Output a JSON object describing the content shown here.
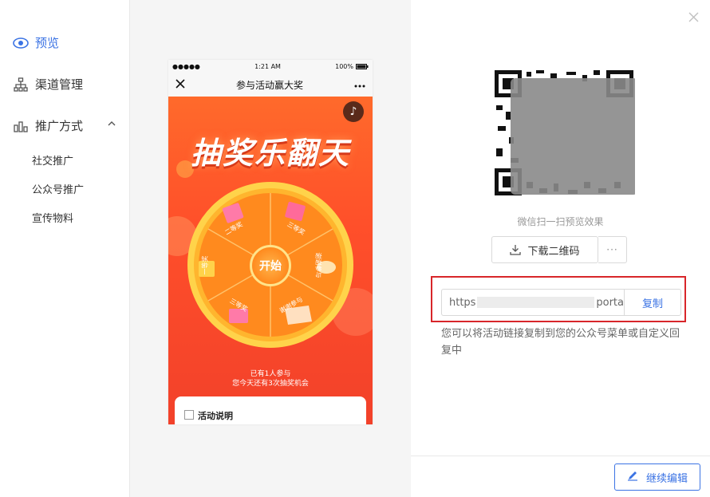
{
  "sidebar": {
    "items": [
      {
        "label": "预览",
        "icon": "eye-icon",
        "active": true
      },
      {
        "label": "渠道管理",
        "icon": "org-chart-icon"
      },
      {
        "label": "推广方式",
        "icon": "bar-chart-icon"
      }
    ],
    "sub_items": [
      "社交推广",
      "公众号推广",
      "宣传物料"
    ]
  },
  "phone": {
    "status_dots": "●●●●●",
    "status_time": "1:21 AM",
    "status_battery": "100%",
    "title": "参与活动赢大奖",
    "hero_title": "抽奖乐翻天",
    "wheel_labels": [
      "二等奖",
      "三等奖",
      "谢谢参与",
      "谢谢参与",
      "一等奖",
      "三等奖"
    ],
    "start_label": "开始",
    "participants_line": "已有1人参与",
    "chances_line": "您今天还有3次抽奖机会",
    "card_title": "活动说明"
  },
  "panel": {
    "qr_caption": "微信扫一扫预览效果",
    "download_label": "下载二维码",
    "more_label": "···",
    "link_prefix": "https",
    "link_suffix": "porta",
    "copy_label": "复制",
    "hint": "您可以将活动链接复制到您的公众号菜单或自定义回复中",
    "edit_label": "继续编辑"
  },
  "colors": {
    "accent": "#3b73e4",
    "highlight_border": "#d8262a",
    "hero_orange": "#ff5a2a"
  }
}
